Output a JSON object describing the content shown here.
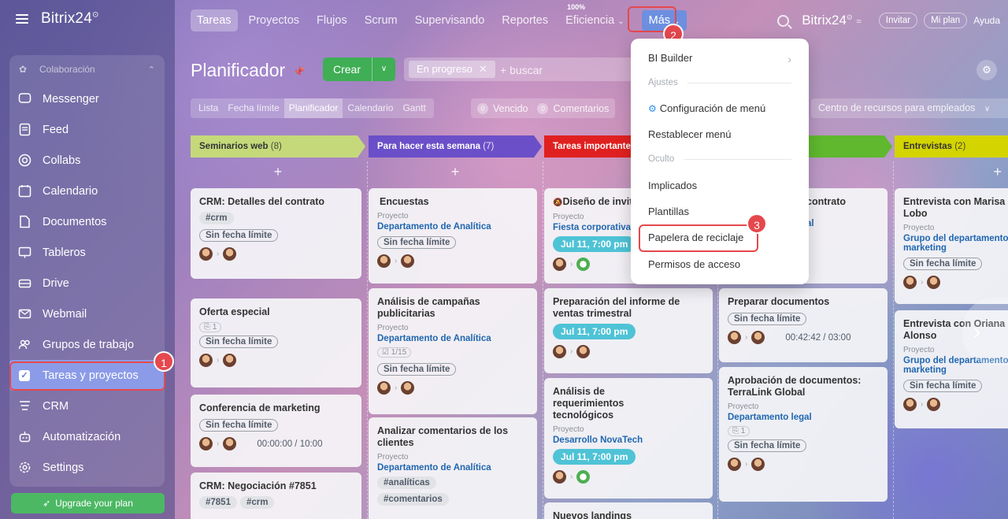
{
  "app": {
    "logo": "Bitrix24"
  },
  "sidebar": {
    "section": "Colaboración",
    "items": [
      {
        "label": "Messenger",
        "icon": "chat-icon"
      },
      {
        "label": "Feed",
        "icon": "feed-icon"
      },
      {
        "label": "Collabs",
        "icon": "collab-icon"
      },
      {
        "label": "Calendario",
        "icon": "calendar-icon"
      },
      {
        "label": "Documentos",
        "icon": "document-icon"
      },
      {
        "label": "Tableros",
        "icon": "board-icon"
      },
      {
        "label": "Drive",
        "icon": "drive-icon"
      },
      {
        "label": "Webmail",
        "icon": "mail-icon"
      },
      {
        "label": "Grupos de trabajo",
        "icon": "group-icon"
      },
      {
        "label": "Tareas y proyectos",
        "icon": "task-icon"
      },
      {
        "label": "CRM",
        "icon": "crm-icon"
      },
      {
        "label": "Automatización",
        "icon": "automation-icon"
      },
      {
        "label": "Settings",
        "icon": "gear-icon"
      }
    ],
    "upgrade": "Upgrade your plan"
  },
  "topnav": {
    "tabs": [
      "Tareas",
      "Proyectos",
      "Flujos",
      "Scrum",
      "Supervisando",
      "Reportes"
    ],
    "efficiency_pct": "100%",
    "efficiency": "Eficiencia",
    "more": "Más",
    "brand": "Bitrix24",
    "invite": "Invitar",
    "myplan": "Mi plan",
    "help": "Ayuda"
  },
  "planner": {
    "title": "Planificador",
    "create": "Crear",
    "filter_chip": "En progreso",
    "search_placeholder": "+ buscar",
    "views": [
      "Lista",
      "Fecha límite",
      "Planificador",
      "Calendario",
      "Gantt"
    ],
    "overdue_count": "0",
    "overdue": "Vencido",
    "comments_count": "0",
    "comments": "Comentarios",
    "resources": "Centro de recursos para empleados"
  },
  "columns": [
    {
      "title": "Seminarios web",
      "count": "(8)",
      "color": "#c5d97a"
    },
    {
      "title": "Para hacer esta semana",
      "count": "(7)",
      "color": "#6a4fc8"
    },
    {
      "title": "Tareas importantes",
      "count": "",
      "color": "#e02020"
    },
    {
      "title": "",
      "count": "",
      "color": "#5fb82e"
    },
    {
      "title": "Entrevistas",
      "count": "(2)",
      "color": "#d4d400"
    }
  ],
  "cards": {
    "c1": {
      "title": "CRM: Detalles del contrato",
      "tag": "#crm",
      "nodl": "Sin fecha límite"
    },
    "c2": {
      "title": "Oferta especial",
      "meta": "1",
      "nodl": "Sin fecha límite"
    },
    "c3": {
      "title": "Conferencia de marketing",
      "nodl": "Sin fecha límite",
      "time": "00:00:00 / 10:00"
    },
    "c4": {
      "title": "CRM: Negociación #7851",
      "tag1": "#7851",
      "tag2": "#crm"
    },
    "d1": {
      "title": "Encuestas",
      "proj": "Proyecto",
      "grp": "Departamento de Analítica",
      "nodl": "Sin fecha límite"
    },
    "d2": {
      "title": "Análisis de campañas publicitarias",
      "proj": "Proyecto",
      "grp": "Departamento de Analítica",
      "meta": "1/15",
      "nodl": "Sin fecha límite"
    },
    "d3": {
      "title": "Analizar comentarios de los clientes",
      "proj": "Proyecto",
      "grp": "Departamento de Analítica",
      "tag1": "#analíticas",
      "tag2": "#comentarios"
    },
    "e1": {
      "title": "Diseño de invitaciones",
      "proj": "Proyecto",
      "grp": "Fiesta corporativa",
      "time": "Jul 11, 7:00 pm"
    },
    "e2": {
      "title": "Preparación del informe de ventas trimestral",
      "time": "Jul 11, 7:00 pm"
    },
    "e3": {
      "title": "Análisis de requerimientos tecnológicos",
      "proj": "Proyecto",
      "grp": "Desarrollo NovaTech",
      "time": "Jul 11, 7:00 pm"
    },
    "e4": {
      "title": "Nuevos landings"
    },
    "f1": {
      "title": "contrato",
      "grp": "al"
    },
    "f2": {
      "title": "Preparar documentos",
      "nodl": "Sin fecha límite",
      "time": "00:42:42 / 03:00"
    },
    "f3": {
      "title": "Aprobación de documentos: TerraLink Global",
      "proj": "Proyecto",
      "grp": "Departamento legal",
      "meta": "1",
      "nodl": "Sin fecha límite"
    },
    "g1": {
      "title": "Entrevista con Marisa Lobo",
      "proj": "Proyecto",
      "grp": "Grupo del departamento de marketing",
      "nodl": "Sin fecha límite"
    },
    "g2": {
      "title": "Entrevista con Oriana Alonso",
      "proj": "Proyecto",
      "grp": "Grupo del departamento de marketing",
      "nodl": "Sin fecha límite"
    }
  },
  "dropdown": {
    "bi_builder": "BI Builder",
    "settings_section": "Ajustes",
    "menu_config": "Configuración de menú",
    "reset_menu": "Restablecer menú",
    "hidden_section": "Oculto",
    "involved": "Implicados",
    "templates": "Plantillas",
    "recycle_bin": "Papelera de reciclaje",
    "access": "Permisos de acceso"
  },
  "callouts": [
    "1",
    "2",
    "3"
  ]
}
